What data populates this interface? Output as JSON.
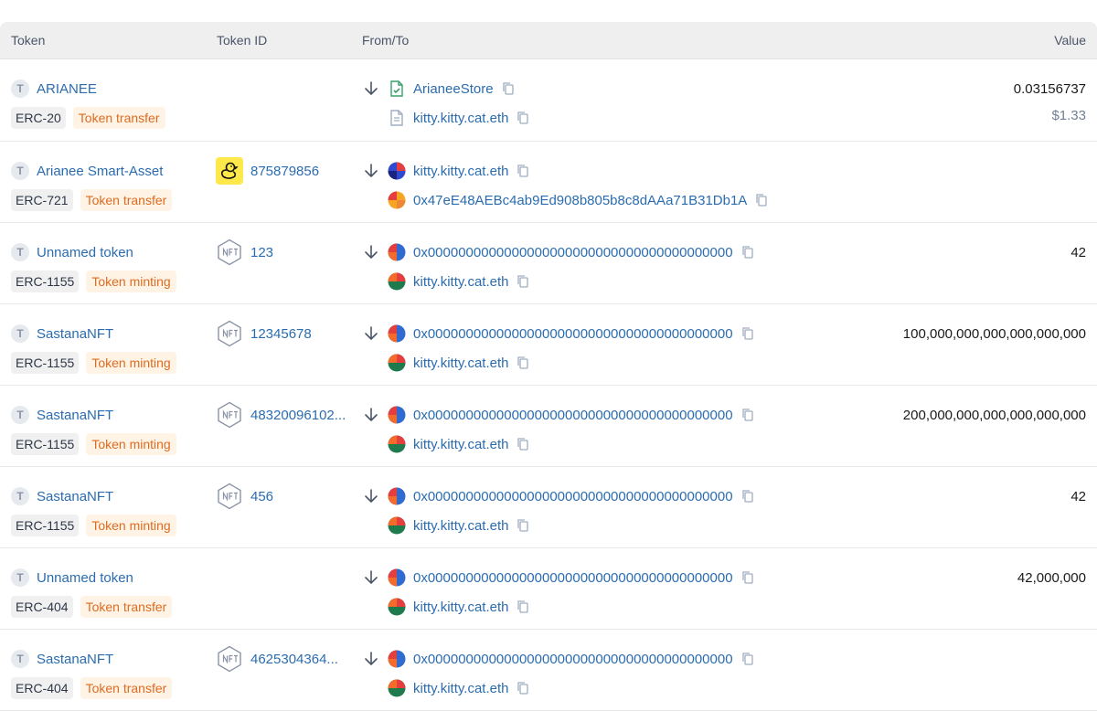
{
  "header": {
    "token": "Token",
    "token_id": "Token ID",
    "from_to": "From/To",
    "value": "Value"
  },
  "rows": [
    {
      "token_name": "ARIANEE",
      "standard": "ERC-20",
      "type": "Token transfer",
      "token_id": "",
      "from": "ArianeeStore",
      "to": "kitty.kitty.cat.eth",
      "value": "0.03156737",
      "usd": "$1.33"
    },
    {
      "token_name": "Arianee Smart-Asset",
      "standard": "ERC-721",
      "type": "Token transfer",
      "token_id": "875879856",
      "from": "kitty.kitty.cat.eth",
      "to": "0x47eE48AEBc4ab9Ed908b805b8c8dAAa71B31Db1A",
      "value": ""
    },
    {
      "token_name": "Unnamed token",
      "standard": "ERC-1155",
      "type": "Token minting",
      "token_id": "123",
      "from": "0x0000000000000000000000000000000000000000",
      "to": "kitty.kitty.cat.eth",
      "value": "42"
    },
    {
      "token_name": "SastanaNFT",
      "standard": "ERC-1155",
      "type": "Token minting",
      "token_id": "12345678",
      "from": "0x0000000000000000000000000000000000000000",
      "to": "kitty.kitty.cat.eth",
      "value": "100,000,000,000,000,000,000"
    },
    {
      "token_name": "SastanaNFT",
      "standard": "ERC-1155",
      "type": "Token minting",
      "token_id": "48320096102...",
      "from": "0x0000000000000000000000000000000000000000",
      "to": "kitty.kitty.cat.eth",
      "value": "200,000,000,000,000,000,000"
    },
    {
      "token_name": "SastanaNFT",
      "standard": "ERC-1155",
      "type": "Token minting",
      "token_id": "456",
      "from": "0x0000000000000000000000000000000000000000",
      "to": "kitty.kitty.cat.eth",
      "value": "42"
    },
    {
      "token_name": "Unnamed token",
      "standard": "ERC-404",
      "type": "Token transfer",
      "token_id": "",
      "from": "0x0000000000000000000000000000000000000000",
      "to": "kitty.kitty.cat.eth",
      "value": "42,000,000"
    },
    {
      "token_name": "SastanaNFT",
      "standard": "ERC-404",
      "type": "Token transfer",
      "token_id": "4625304364...",
      "from": "0x0000000000000000000000000000000000000000",
      "to": "kitty.kitty.cat.eth",
      "value": ""
    }
  ],
  "token_avatar_letter": "T",
  "colors": {
    "link": "#2b6cb0",
    "tag_type_text": "#dd6b20",
    "tag_type_bg": "#fff3e6",
    "tag_std_bg": "#f0f0f0",
    "header_bg": "#efefef"
  }
}
